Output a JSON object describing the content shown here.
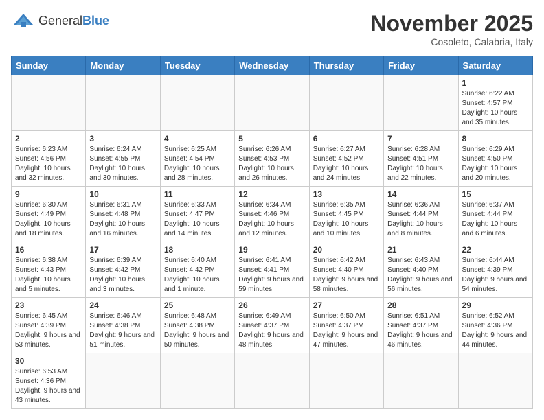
{
  "logo": {
    "text_regular": "General",
    "text_bold": "Blue"
  },
  "title": "November 2025",
  "location": "Cosoleto, Calabria, Italy",
  "weekdays": [
    "Sunday",
    "Monday",
    "Tuesday",
    "Wednesday",
    "Thursday",
    "Friday",
    "Saturday"
  ],
  "weeks": [
    [
      {
        "day": "",
        "info": ""
      },
      {
        "day": "",
        "info": ""
      },
      {
        "day": "",
        "info": ""
      },
      {
        "day": "",
        "info": ""
      },
      {
        "day": "",
        "info": ""
      },
      {
        "day": "",
        "info": ""
      },
      {
        "day": "1",
        "info": "Sunrise: 6:22 AM\nSunset: 4:57 PM\nDaylight: 10 hours and 35 minutes."
      }
    ],
    [
      {
        "day": "2",
        "info": "Sunrise: 6:23 AM\nSunset: 4:56 PM\nDaylight: 10 hours and 32 minutes."
      },
      {
        "day": "3",
        "info": "Sunrise: 6:24 AM\nSunset: 4:55 PM\nDaylight: 10 hours and 30 minutes."
      },
      {
        "day": "4",
        "info": "Sunrise: 6:25 AM\nSunset: 4:54 PM\nDaylight: 10 hours and 28 minutes."
      },
      {
        "day": "5",
        "info": "Sunrise: 6:26 AM\nSunset: 4:53 PM\nDaylight: 10 hours and 26 minutes."
      },
      {
        "day": "6",
        "info": "Sunrise: 6:27 AM\nSunset: 4:52 PM\nDaylight: 10 hours and 24 minutes."
      },
      {
        "day": "7",
        "info": "Sunrise: 6:28 AM\nSunset: 4:51 PM\nDaylight: 10 hours and 22 minutes."
      },
      {
        "day": "8",
        "info": "Sunrise: 6:29 AM\nSunset: 4:50 PM\nDaylight: 10 hours and 20 minutes."
      }
    ],
    [
      {
        "day": "9",
        "info": "Sunrise: 6:30 AM\nSunset: 4:49 PM\nDaylight: 10 hours and 18 minutes."
      },
      {
        "day": "10",
        "info": "Sunrise: 6:31 AM\nSunset: 4:48 PM\nDaylight: 10 hours and 16 minutes."
      },
      {
        "day": "11",
        "info": "Sunrise: 6:33 AM\nSunset: 4:47 PM\nDaylight: 10 hours and 14 minutes."
      },
      {
        "day": "12",
        "info": "Sunrise: 6:34 AM\nSunset: 4:46 PM\nDaylight: 10 hours and 12 minutes."
      },
      {
        "day": "13",
        "info": "Sunrise: 6:35 AM\nSunset: 4:45 PM\nDaylight: 10 hours and 10 minutes."
      },
      {
        "day": "14",
        "info": "Sunrise: 6:36 AM\nSunset: 4:44 PM\nDaylight: 10 hours and 8 minutes."
      },
      {
        "day": "15",
        "info": "Sunrise: 6:37 AM\nSunset: 4:44 PM\nDaylight: 10 hours and 6 minutes."
      }
    ],
    [
      {
        "day": "16",
        "info": "Sunrise: 6:38 AM\nSunset: 4:43 PM\nDaylight: 10 hours and 5 minutes."
      },
      {
        "day": "17",
        "info": "Sunrise: 6:39 AM\nSunset: 4:42 PM\nDaylight: 10 hours and 3 minutes."
      },
      {
        "day": "18",
        "info": "Sunrise: 6:40 AM\nSunset: 4:42 PM\nDaylight: 10 hours and 1 minute."
      },
      {
        "day": "19",
        "info": "Sunrise: 6:41 AM\nSunset: 4:41 PM\nDaylight: 9 hours and 59 minutes."
      },
      {
        "day": "20",
        "info": "Sunrise: 6:42 AM\nSunset: 4:40 PM\nDaylight: 9 hours and 58 minutes."
      },
      {
        "day": "21",
        "info": "Sunrise: 6:43 AM\nSunset: 4:40 PM\nDaylight: 9 hours and 56 minutes."
      },
      {
        "day": "22",
        "info": "Sunrise: 6:44 AM\nSunset: 4:39 PM\nDaylight: 9 hours and 54 minutes."
      }
    ],
    [
      {
        "day": "23",
        "info": "Sunrise: 6:45 AM\nSunset: 4:39 PM\nDaylight: 9 hours and 53 minutes."
      },
      {
        "day": "24",
        "info": "Sunrise: 6:46 AM\nSunset: 4:38 PM\nDaylight: 9 hours and 51 minutes."
      },
      {
        "day": "25",
        "info": "Sunrise: 6:48 AM\nSunset: 4:38 PM\nDaylight: 9 hours and 50 minutes."
      },
      {
        "day": "26",
        "info": "Sunrise: 6:49 AM\nSunset: 4:37 PM\nDaylight: 9 hours and 48 minutes."
      },
      {
        "day": "27",
        "info": "Sunrise: 6:50 AM\nSunset: 4:37 PM\nDaylight: 9 hours and 47 minutes."
      },
      {
        "day": "28",
        "info": "Sunrise: 6:51 AM\nSunset: 4:37 PM\nDaylight: 9 hours and 46 minutes."
      },
      {
        "day": "29",
        "info": "Sunrise: 6:52 AM\nSunset: 4:36 PM\nDaylight: 9 hours and 44 minutes."
      }
    ],
    [
      {
        "day": "30",
        "info": "Sunrise: 6:53 AM\nSunset: 4:36 PM\nDaylight: 9 hours and 43 minutes."
      },
      {
        "day": "",
        "info": ""
      },
      {
        "day": "",
        "info": ""
      },
      {
        "day": "",
        "info": ""
      },
      {
        "day": "",
        "info": ""
      },
      {
        "day": "",
        "info": ""
      },
      {
        "day": "",
        "info": ""
      }
    ]
  ]
}
